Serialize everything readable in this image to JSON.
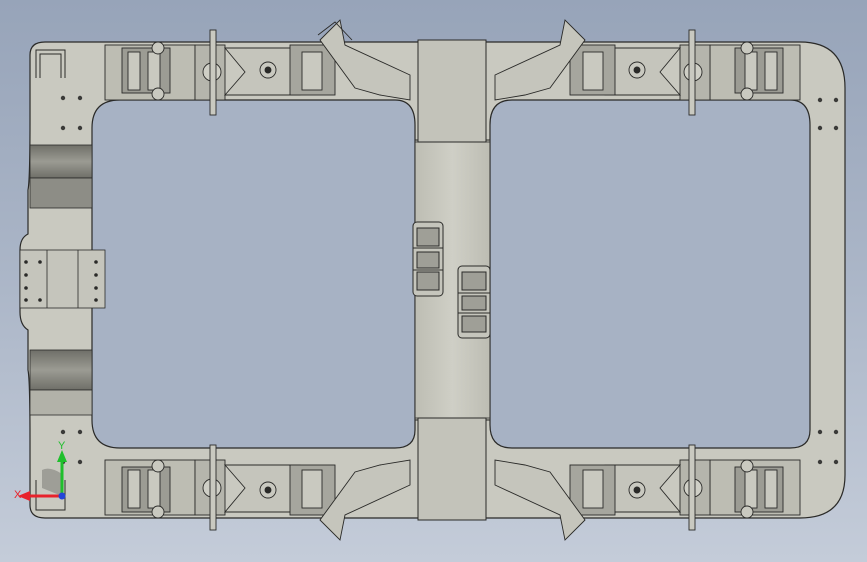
{
  "viewport": {
    "background_top": "#97a4b9",
    "background_bottom": "#c4ccd9"
  },
  "model": {
    "name": "vehicle-chassis-frame",
    "fill_color": "#c9c9c0",
    "shade_color": "#a9a99f",
    "dark_shade_color": "#7c7c74",
    "edge_color": "#2a2a28"
  },
  "triad": {
    "x_label": "X",
    "y_label": "Y",
    "x_color": "#e8222b",
    "y_color": "#1fbf2c",
    "z_color": "#2346d8"
  }
}
